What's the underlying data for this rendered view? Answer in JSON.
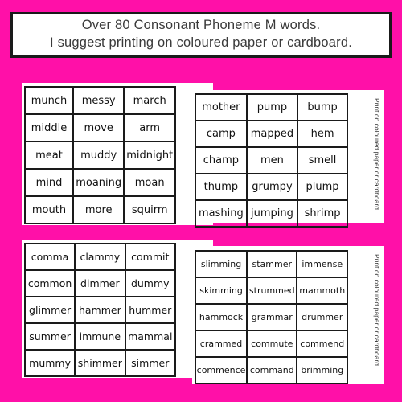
{
  "background_color": "#FF10A8",
  "header": {
    "line1": "Over 80 Consonant Phoneme M words.",
    "line2": "I suggest printing on coloured paper or cardboard."
  },
  "cards": [
    {
      "id": "top-left",
      "rows": [
        [
          "munch",
          "messy",
          "march"
        ],
        [
          "middle",
          "move",
          "arm"
        ],
        [
          "meat",
          "muddy",
          "midnight"
        ],
        [
          "mind",
          "moaning",
          "moan"
        ],
        [
          "mouth",
          "more",
          "squirm"
        ]
      ]
    },
    {
      "id": "top-right",
      "side_note": "Print on coloured paper or cardboard",
      "rows": [
        [
          "mother",
          "pump",
          "bump"
        ],
        [
          "camp",
          "mapped",
          "hem"
        ],
        [
          "champ",
          "men",
          "smell"
        ],
        [
          "thump",
          "grumpy",
          "plump"
        ],
        [
          "mashing",
          "jumping",
          "shrimp"
        ]
      ]
    },
    {
      "id": "bottom-left",
      "rows": [
        [
          "comma",
          "clammy",
          "commit"
        ],
        [
          "common",
          "dimmer",
          "dummy"
        ],
        [
          "glimmer",
          "hammer",
          "hummer"
        ],
        [
          "summer",
          "immune",
          "mammal"
        ],
        [
          "mummy",
          "shimmer",
          "simmer"
        ]
      ]
    },
    {
      "id": "bottom-right",
      "side_note": "Print on coloured paper or cardboard",
      "rows": [
        [
          "slimming",
          "stammer",
          "immense"
        ],
        [
          "skimming",
          "strummed",
          "mammoth"
        ],
        [
          "hammock",
          "grammar",
          "drummer"
        ],
        [
          "crammed",
          "commute",
          "commend"
        ],
        [
          "commence",
          "command",
          "brimming"
        ]
      ]
    }
  ]
}
